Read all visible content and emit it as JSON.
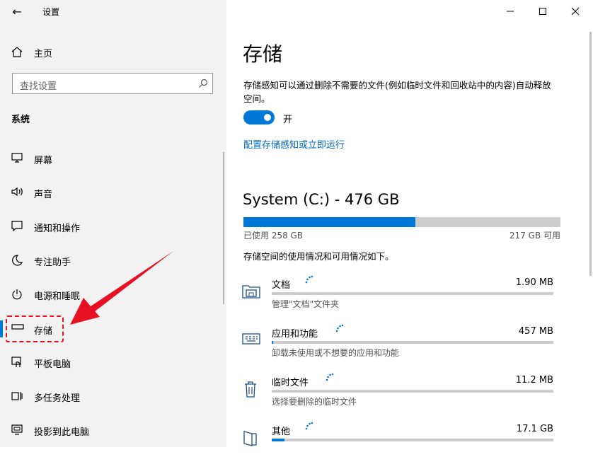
{
  "sidebar": {
    "back_glyph": "←",
    "app_title": "设置",
    "home_label": "主页",
    "search_placeholder": "查找设置",
    "section_title": "系统",
    "items": [
      {
        "icon": "display-icon",
        "label": "屏幕"
      },
      {
        "icon": "speaker-icon",
        "label": "声音"
      },
      {
        "icon": "notification-icon",
        "label": "通知和操作"
      },
      {
        "icon": "moon-icon",
        "label": "专注助手"
      },
      {
        "icon": "power-icon",
        "label": "电源和睡眠"
      },
      {
        "icon": "storage-icon",
        "label": "存储",
        "active": true
      },
      {
        "icon": "tablet-icon",
        "label": "平板电脑"
      },
      {
        "icon": "multitask-icon",
        "label": "多任务处理"
      },
      {
        "icon": "project-icon",
        "label": "投影到此电脑"
      }
    ]
  },
  "main": {
    "title": "存储",
    "description": "存储感知可以通过删除不需要的文件(例如临时文件和回收站中的内容)自动释放空间。",
    "toggle": {
      "state_label": "开",
      "on": true
    },
    "link": "配置存储感知或立即运行",
    "drive": {
      "title": "System (C:) - 476 GB",
      "used_label": "已使用 258 GB",
      "free_label": "217 GB 可用",
      "used_fraction": 0.542
    },
    "usage_description": "存储空间的使用情况和可用情况如下。",
    "categories": [
      {
        "icon": "documents-icon",
        "name": "文档",
        "size": "1.90 MB",
        "sub": "管理\"文档\"文件夹",
        "fraction": 0.0
      },
      {
        "icon": "apps-icon",
        "name": "应用和功能",
        "size": "457 MB",
        "sub": "卸载未使用或不想要的应用和功能",
        "fraction": 0.003
      },
      {
        "icon": "trash-icon",
        "name": "临时文件",
        "size": "11.2 MB",
        "sub": "选择要删除的临时文件",
        "fraction": 0.0
      },
      {
        "icon": "other-icon",
        "name": "其他",
        "size": "17.1 GB",
        "sub": "",
        "fraction": 0.045
      }
    ]
  },
  "colors": {
    "accent": "#0078d7",
    "annotation": "#e81123",
    "link": "#0067b8"
  }
}
